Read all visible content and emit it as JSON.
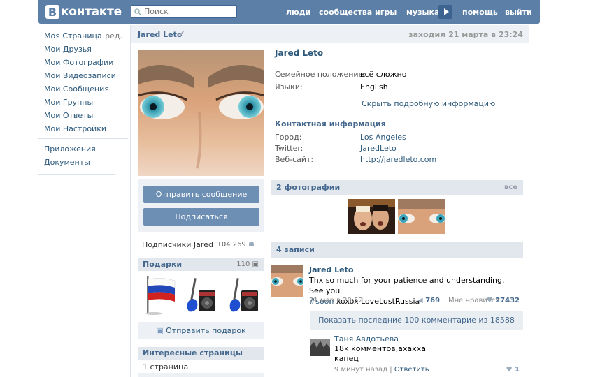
{
  "header": {
    "logo_letter": "В",
    "logo_text": "контакте",
    "search_placeholder": "Поиск",
    "nav": [
      "люди",
      "сообщества",
      "игры",
      "музыка",
      "помощь",
      "выйти"
    ]
  },
  "sidebar": {
    "items": [
      {
        "label": "Моя Страница",
        "edit": "ред."
      },
      {
        "label": "Мои Друзья"
      },
      {
        "label": "Мои Фотографии"
      },
      {
        "label": "Мои Видеозаписи"
      },
      {
        "label": "Мои Сообщения"
      },
      {
        "label": "Мои Группы"
      },
      {
        "label": "Мои Ответы"
      },
      {
        "label": "Мои Настройки"
      }
    ],
    "extra": [
      "Приложения",
      "Документы"
    ]
  },
  "profile": {
    "name": "Jared Leto",
    "last_seen": "заходил 21 марта в 23:24",
    "send_message": "Отправить сообщение",
    "subscribe": "Подписаться",
    "subscribers_label": "Подписчики Jared",
    "subscribers_count": "104 269",
    "gifts_title": "Подарки",
    "gifts_count": "110",
    "send_gift": "Отправить подарок",
    "pages_title": "Интересные страницы",
    "pages_count": "1 страница"
  },
  "info": {
    "name": "Jared Leto",
    "family_label": "Семейное положение:",
    "family_value": "всё сложно",
    "lang_label": "Языки:",
    "lang_value": "English",
    "hide_link": "Скрыть подробную информацию",
    "contact_title": "Контактная информация",
    "city_label": "Город:",
    "city_value": "Los Angeles",
    "twitter_label": "Twitter:",
    "twitter_value": "JaredLeto",
    "site_label": "Веб-сайт:",
    "site_value": "http://jaredleto.com"
  },
  "photos": {
    "title": "2 фотографии",
    "all": "все"
  },
  "wall": {
    "title": "4 записи",
    "post": {
      "author": "Jared Leto",
      "text_1": "Thx so much for your patience and understanding. See you",
      "hashtag": "#soon",
      "text_2": " xoxox LoveLustRussia",
      "date": "21 мар в 20:52",
      "reposts": "769",
      "like_label": "Мне нравится",
      "likes": "27432"
    },
    "show_comments": "Показать последние 100 комментарие из 18588",
    "comment": {
      "author": "Таня Авдотьева",
      "line1": "18к комментов,ахахха",
      "line2": "капец",
      "time": "9 минут назад",
      "reply": "Ответить",
      "likes": "1"
    }
  },
  "colors": {
    "header": "#5b7fa6",
    "link": "#2b587a",
    "button": "#6d8fb3",
    "section_bg": "#e1e7ed"
  }
}
